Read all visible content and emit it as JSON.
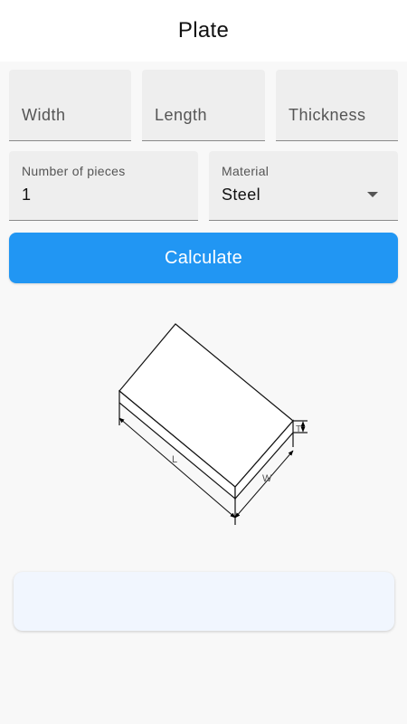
{
  "appbar": {
    "title": "Plate"
  },
  "form": {
    "width": {
      "placeholder": "Width"
    },
    "length": {
      "placeholder": "Length"
    },
    "thickness": {
      "placeholder": "Thickness"
    },
    "pieces": {
      "label": "Number of pieces",
      "value": "1"
    },
    "material": {
      "label": "Material",
      "value": "Steel"
    }
  },
  "calculate_button": {
    "label": "Calculate"
  },
  "diagram": {
    "labels": {
      "length": "L",
      "width": "W",
      "thickness": "T"
    }
  },
  "colors": {
    "accent": "#2196f3",
    "field_bg": "#eeeeee",
    "card_bg": "#f1f6fe"
  }
}
